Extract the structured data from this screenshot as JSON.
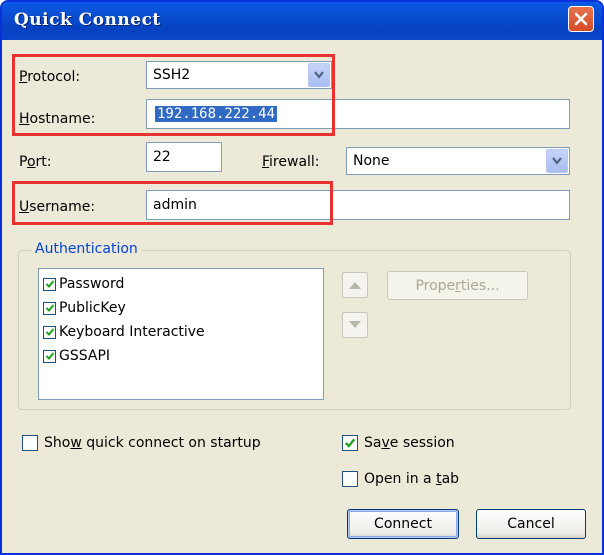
{
  "window": {
    "title": "Quick Connect"
  },
  "protocol": {
    "label_pre": "",
    "label_u": "P",
    "label_post": "rotocol:",
    "value": "SSH2"
  },
  "hostname": {
    "label_pre": "",
    "label_u": "H",
    "label_post": "ostname:",
    "value": "192.168.222.44"
  },
  "port": {
    "label_pre": "P",
    "label_u": "o",
    "label_post": "rt:",
    "value": "22"
  },
  "firewall": {
    "label_pre": "",
    "label_u": "F",
    "label_post": "irewall:",
    "value": "None"
  },
  "username": {
    "label_pre": "",
    "label_u": "U",
    "label_post": "sername:",
    "value": "admin"
  },
  "authentication": {
    "title": "Authentication",
    "methods": [
      {
        "label": "Password",
        "checked": true
      },
      {
        "label": "PublicKey",
        "checked": true
      },
      {
        "label": "Keyboard Interactive",
        "checked": true
      },
      {
        "label": "GSSAPI",
        "checked": true
      }
    ],
    "properties_pre": "Prope",
    "properties_u": "r",
    "properties_post": "ties..."
  },
  "options": {
    "show_quick_connect_pre": "Sho",
    "show_quick_connect_u": "w",
    "show_quick_connect_post": " quick connect on startup",
    "show_quick_connect_checked": false,
    "save_session_pre": "Sa",
    "save_session_u": "v",
    "save_session_post": "e session",
    "save_session_checked": true,
    "open_in_tab_pre": "Open in a ",
    "open_in_tab_u": "t",
    "open_in_tab_post": "ab",
    "open_in_tab_checked": false
  },
  "buttons": {
    "connect": "Connect",
    "cancel": "Cancel"
  },
  "colors": {
    "highlight": "#e8322f",
    "titlebar": "#0a4fd4",
    "selection": "#316ac5",
    "group_title": "#0046d5"
  },
  "icons": {
    "close": "close-icon",
    "dropdown": "chevron-down-icon",
    "check": "checkmark-icon",
    "up": "arrow-up-icon",
    "down": "arrow-down-icon"
  }
}
